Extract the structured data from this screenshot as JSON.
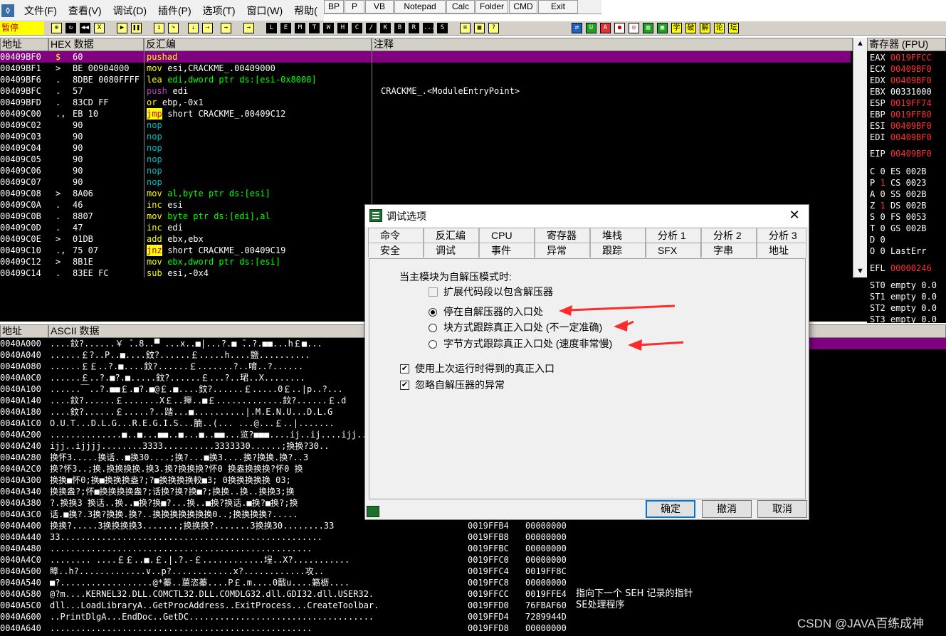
{
  "menubar": {
    "items": [
      "文件(F)",
      "查看(V)",
      "调试(D)",
      "插件(P)",
      "选项(T)",
      "窗口(W)",
      "帮助("
    ]
  },
  "plugin_buttons": [
    "BP",
    "P",
    "VB",
    "Notepad",
    "Calc",
    "Folder",
    "CMD",
    "Exit"
  ],
  "toolbar": {
    "status": "暂停",
    "letters": [
      "L",
      "E",
      "M",
      "T",
      "W",
      "H",
      "C",
      "/",
      "K",
      "B",
      "R",
      "...",
      "S"
    ],
    "chinese_buttons": [
      "学",
      "破",
      "解",
      "论",
      "坛"
    ]
  },
  "disasm": {
    "headers": {
      "addr": "地址",
      "hex": "HEX 数据",
      "dis": "反汇编",
      "comment": "注释"
    },
    "rows": [
      {
        "addr": "00409BF0",
        "mark": "$",
        "hex": "60",
        "op": "pushad",
        "args": "",
        "comment": "",
        "selected": true
      },
      {
        "addr": "00409BF1",
        "mark": ">",
        "hex": "BE 00904000",
        "op": "mov",
        "args": "esi,CRACKME_.00409000",
        "comment": ""
      },
      {
        "addr": "00409BF6",
        "mark": ".",
        "hex": "8DBE 0080FFFF",
        "op": "lea",
        "args": "edi,dword ptr ds:[esi-0x8000]",
        "comment": ""
      },
      {
        "addr": "00409BFC",
        "mark": ".",
        "hex": "57",
        "op": "push",
        "args": "edi",
        "comment": "CRACKME_.<ModuleEntryPoint>"
      },
      {
        "addr": "00409BFD",
        "mark": ".",
        "hex": "83CD FF",
        "op": "or",
        "args": "ebp,-0x1",
        "comment": ""
      },
      {
        "addr": "00409C00",
        "mark": ".,",
        "hex": "EB 10",
        "op": "jmp",
        "args": "short CRACKME_.00409C12",
        "comment": ""
      },
      {
        "addr": "00409C02",
        "mark": "",
        "hex": "90",
        "op": "nop",
        "args": "",
        "comment": ""
      },
      {
        "addr": "00409C03",
        "mark": "",
        "hex": "90",
        "op": "nop",
        "args": "",
        "comment": ""
      },
      {
        "addr": "00409C04",
        "mark": "",
        "hex": "90",
        "op": "nop",
        "args": "",
        "comment": ""
      },
      {
        "addr": "00409C05",
        "mark": "",
        "hex": "90",
        "op": "nop",
        "args": "",
        "comment": ""
      },
      {
        "addr": "00409C06",
        "mark": "",
        "hex": "90",
        "op": "nop",
        "args": "",
        "comment": ""
      },
      {
        "addr": "00409C07",
        "mark": "",
        "hex": "90",
        "op": "nop",
        "args": "",
        "comment": ""
      },
      {
        "addr": "00409C08",
        "mark": ">",
        "hex": "8A06",
        "op": "mov",
        "args": "al,byte ptr ds:[esi]",
        "comment": ""
      },
      {
        "addr": "00409C0A",
        "mark": ".",
        "hex": "46",
        "op": "inc",
        "args": "esi",
        "comment": ""
      },
      {
        "addr": "00409C0B",
        "mark": ".",
        "hex": "8807",
        "op": "mov",
        "args": "byte ptr ds:[edi],al",
        "comment": ""
      },
      {
        "addr": "00409C0D",
        "mark": ".",
        "hex": "47",
        "op": "inc",
        "args": "edi",
        "comment": ""
      },
      {
        "addr": "00409C0E",
        "mark": ">",
        "hex": "01DB",
        "op": "add",
        "args": "ebx,ebx",
        "comment": ""
      },
      {
        "addr": "00409C10",
        "mark": ".,",
        "hex": "75 07",
        "op": "jnz",
        "args": "short CRACKME_.00409C19",
        "comment": ""
      },
      {
        "addr": "00409C12",
        "mark": ">",
        "hex": "8B1E",
        "op": "mov",
        "args": "ebx,dword ptr ds:[esi]",
        "comment": ""
      },
      {
        "addr": "00409C14",
        "mark": ".",
        "hex": "83EE FC",
        "op": "sub",
        "args": "esi,-0x4",
        "comment": ""
      }
    ]
  },
  "registers": {
    "title": "寄存器 (FPU)",
    "main": [
      {
        "name": "EAX",
        "value": "0019FFCC"
      },
      {
        "name": "ECX",
        "value": "00409BF0"
      },
      {
        "name": "EDX",
        "value": "00409BF0"
      },
      {
        "name": "EBX",
        "value": "00331000"
      },
      {
        "name": "ESP",
        "value": "0019FF74"
      },
      {
        "name": "EBP",
        "value": "0019FF80"
      },
      {
        "name": "ESI",
        "value": "00409BF0"
      },
      {
        "name": "EDI",
        "value": "00409BF0"
      }
    ],
    "eip": {
      "name": "EIP",
      "value": "00409BF0"
    },
    "flags": [
      {
        "f": "C",
        "v": "0",
        "seg": "ES",
        "sv": "002B"
      },
      {
        "f": "P",
        "v": "1",
        "seg": "CS",
        "sv": "0023"
      },
      {
        "f": "A",
        "v": "0",
        "seg": "SS",
        "sv": "002B"
      },
      {
        "f": "Z",
        "v": "1",
        "seg": "DS",
        "sv": "002B"
      },
      {
        "f": "S",
        "v": "0",
        "seg": "FS",
        "sv": "0053"
      },
      {
        "f": "T",
        "v": "0",
        "seg": "GS",
        "sv": "002B"
      },
      {
        "f": "D",
        "v": "0",
        "seg": "",
        "sv": ""
      },
      {
        "f": "O",
        "v": "0",
        "seg": "LastErr",
        "sv": ""
      }
    ],
    "efl": {
      "name": "EFL",
      "value": "00000246"
    },
    "fpu": [
      "ST0 empty 0.0",
      "ST1 empty 0.0",
      "ST2 empty 0.0",
      "ST3 empty 0.0"
    ]
  },
  "dump": {
    "headers": {
      "addr": "地址",
      "ascii": "ASCII 数据"
    },
    "rows": [
      {
        "addr": "0040A000",
        "text": "....鈫?......￥ ̄..8..▀ ...x..■|...?.■ ̄..?.■■...h￡■..."
      },
      {
        "addr": "0040A040",
        "text": "......￡?..P..■....鈫?......￡.....h....鹽.........."
      },
      {
        "addr": "0040A080",
        "text": "......￡￡..?.■....鈫?......￡.......?..唷..?......"
      },
      {
        "addr": "0040A0C0",
        "text": "......￡..?.■?.■.....鈫?......￡...?..珺..X........"
      },
      {
        "addr": "0040A100",
        "text": "......￣..?.■■￡.■?.■@￡.■....鈫?......￡.....0￡..|p..?..."
      },
      {
        "addr": "0040A140",
        "text": "....鈫?......￡.......X￡..攑..■￡.............鈫?......￡.d"
      },
      {
        "addr": "0040A180",
        "text": "....鈫?......￡.....?..踏...■..........|.M.E.N.U...D.L.G"
      },
      {
        "addr": "0040A1C0",
        "text": "O.U.T...D.L.G...R.E.G.I.S...腩..(... ...@...￡..|......."
      },
      {
        "addr": "0040A200",
        "text": "..............■..■...■■..■...■..■■...览?■■■....ij..ij....ijj.."
      },
      {
        "addr": "0040A240",
        "text": "ijj..ijjjj........3333..........3333330......;换换?30.."
      },
      {
        "addr": "0040A280",
        "text": "换怀3.....换话..■换30....;换?...■换3....换?换换.换?..3"
      },
      {
        "addr": "0040A2C0",
        "text": "换?怀3..;换.换换换换.换3.换?换换换?怀0 换盎换换换?怀0 换"
      },
      {
        "addr": "0040A300",
        "text": "换换■怀0;换■换换换盎?;?■换换换换較■3; 0换换换换换 03;"
      },
      {
        "addr": "0040A340",
        "text": "换换盎?;怀■换换换换盎?;话换?换?换■?;换换..换..换换3;换"
      },
      {
        "addr": "0040A380",
        "text": "?.换换3 换话..换..■换?换■?...换..■换?换话.■换?■换?;换"
      },
      {
        "addr": "0040A3C0",
        "text": "话.■换?.3换?换换.换?..换换换换换换换0..;换换换换?....."
      },
      {
        "addr": "0040A400",
        "text": "换换?.....3换换换换3.......;换换换?.......3换换30........33"
      },
      {
        "addr": "0040A440",
        "text": "33..................................................."
      },
      {
        "addr": "0040A480",
        "text": "..................................................."
      },
      {
        "addr": "0040A4C0",
        "text": "........ ....￡￡..■.￡.|.?.-￡............埕..X?..........."
      },
      {
        "addr": "0040A500",
        "text": "瞕..h?.............∨..p?............x?............攻.."
      },
      {
        "addr": "0040A540",
        "text": "■?..................@*蓁..蕙恣蓁....P￡.m....0戬u....籟枥...."
      },
      {
        "addr": "0040A580",
        "text": "@?m....KERNEL32.DLL.COMCTL32.DLL.COMDLG32.dll.GDI32.dll.USER32."
      },
      {
        "addr": "0040A5C0",
        "text": "dll...LoadLibraryA..GetProcAddress..ExitProcess...CreateToolbar."
      },
      {
        "addr": "0040A600",
        "text": "..PrintDlgA...EndDoc..GetDC...................................."
      },
      {
        "addr": "0040A640",
        "text": "..................................................."
      }
    ]
  },
  "stack": {
    "rows": [
      {
        "addr": "0019FFB4",
        "value": "00000000",
        "comment": ""
      },
      {
        "addr": "0019FFB8",
        "value": "00000000",
        "comment": ""
      },
      {
        "addr": "0019FFBC",
        "value": "00000000",
        "comment": ""
      },
      {
        "addr": "0019FFC0",
        "value": "00000000",
        "comment": ""
      },
      {
        "addr": "0019FFC4",
        "value": "0019FF8C",
        "comment": ""
      },
      {
        "addr": "0019FFC8",
        "value": "00000000",
        "comment": ""
      },
      {
        "addr": "0019FFCC",
        "value": "0019FFE4",
        "comment": "指向下一个 SEH 记录的指针"
      },
      {
        "addr": "0019FFD0",
        "value": "76FBAF60",
        "comment": "SE处理程序"
      },
      {
        "addr": "0019FFD4",
        "value": "7289944D",
        "comment": ""
      },
      {
        "addr": "0019FFD8",
        "value": "00000000",
        "comment": ""
      }
    ]
  },
  "watermark": "CSDN @JAVA百练成神",
  "dialog": {
    "title": "调试选项",
    "tabs_row1": [
      "命令",
      "反汇编",
      "CPU",
      "寄存器",
      "堆栈",
      "分析 1",
      "分析 2",
      "分析 3"
    ],
    "tabs_row2": [
      "安全",
      "调试",
      "事件",
      "异常",
      "跟踪",
      "SFX",
      "字串",
      "地址"
    ],
    "active_tab": "SFX",
    "group_label": "当主模块为自解压模式时:",
    "option_extend": "扩展代码段以包含解压器",
    "radio_options": [
      {
        "label": "停在自解压器的入口处",
        "checked": true
      },
      {
        "label": "块方式跟踪真正入口处 (不一定准确)",
        "checked": false
      },
      {
        "label": "字节方式跟踪真正入口处 (速度非常慢)",
        "checked": false
      }
    ],
    "check_options": [
      {
        "label": "使用上次运行时得到的真正入口",
        "checked": true
      },
      {
        "label": "忽略自解压器的异常",
        "checked": true
      }
    ],
    "buttons": {
      "ok": "确定",
      "undo": "撤消",
      "cancel": "取消"
    }
  },
  "colors": {
    "selected_row": "#800080",
    "status_bg": "#ffff00",
    "arrow": "#ff2a2a",
    "register_changed": "#ff3030"
  }
}
